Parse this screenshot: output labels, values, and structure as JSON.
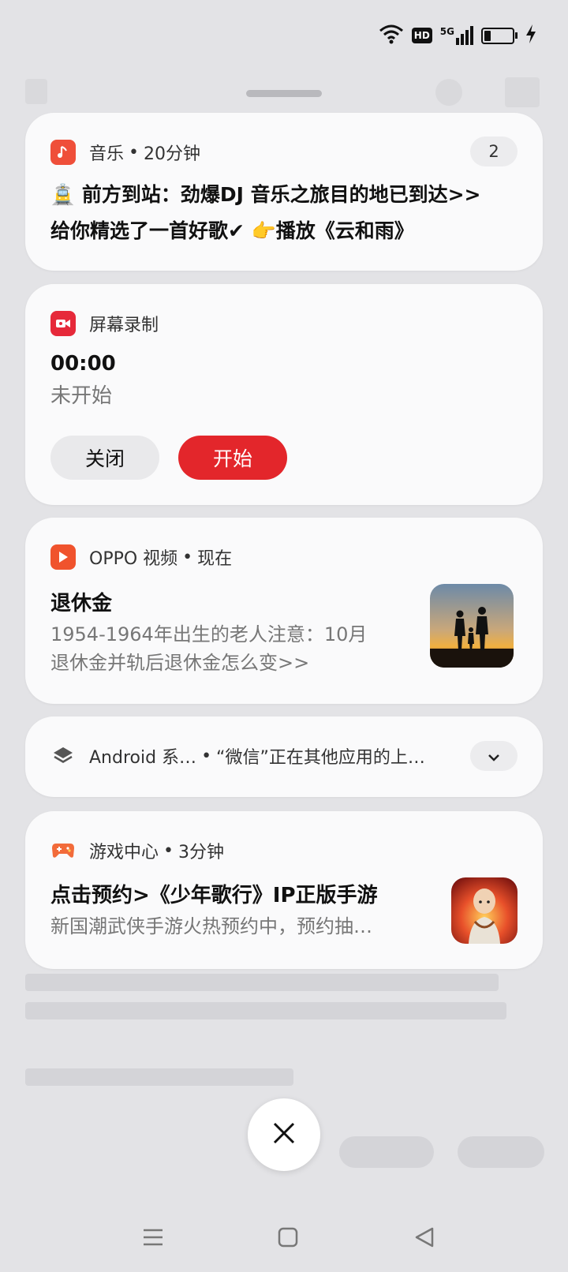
{
  "status_bar": {
    "hd": "HD",
    "net": "5G"
  },
  "notifications": {
    "music": {
      "app_name": "音乐",
      "time": "20分钟",
      "count": "2",
      "line1": "🚊 前方到站：劲爆DJ 音乐之旅目的地已到达>>",
      "line2": "给你精选了一首好歌✔ 👉播放《云和雨》",
      "icon": "music-note-icon",
      "accent": "#ef4f3a"
    },
    "screen_record": {
      "app_name": "屏幕录制",
      "timer": "00:00",
      "status": "未开始",
      "close_label": "关闭",
      "start_label": "开始",
      "icon": "video-camera-icon",
      "accent": "#e6293a"
    },
    "oppo_video": {
      "app_name": "OPPO 视频",
      "time": "现在",
      "title": "退休金",
      "body_line1": "1954-1964年出生的老人注意：10月",
      "body_line2": "退休金并轨后退休金怎么变>>",
      "icon": "play-icon",
      "accent": "#f0532d"
    },
    "android_system": {
      "app_name": "Android 系…",
      "summary": "“微信”正在其他应用的上…",
      "icon": "layers-icon"
    },
    "game_center": {
      "app_name": "游戏中心",
      "time": "3分钟",
      "title": "点击预约>《少年歌行》IP正版手游",
      "body": "新国潮武侠手游火热预约中，预约抽…",
      "icon": "gamepad-icon",
      "accent": "#f26b3a"
    }
  },
  "navigation": {
    "menu_icon": "menu-icon",
    "home_icon": "home-icon",
    "back_icon": "back-icon"
  }
}
